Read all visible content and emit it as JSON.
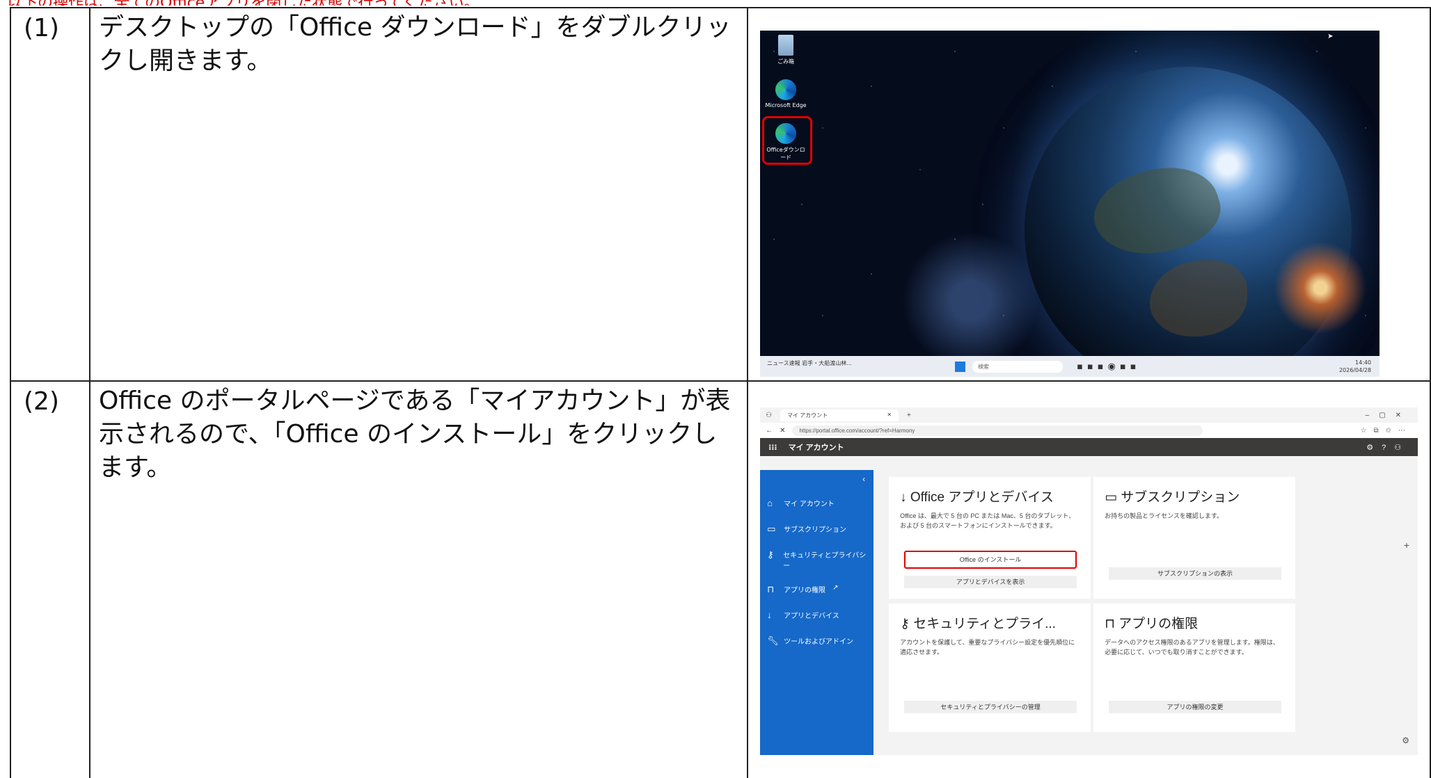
{
  "header_line": "以下の操作は、全てのOfficeアプリを閉じた状態で行ってください。",
  "steps": [
    {
      "number": "(1)",
      "text": "デスクトップの「Office ダウンロード」をダブルクリックし開きます。",
      "desktop": {
        "icons": [
          {
            "label": "ごみ箱",
            "icon": "recycle-bin-icon"
          },
          {
            "label": "Microsoft Edge",
            "icon": "edge-icon"
          },
          {
            "label": "Officeダウンロード",
            "icon": "edge-icon"
          }
        ],
        "taskbar": {
          "news": "ニュース速報 岩手・大船渡山林...",
          "search": "検索",
          "time": "14:40",
          "date": "2026/04/28"
        }
      }
    },
    {
      "number": "(2)",
      "text": "Office のポータルページである「マイアカウント」が表示されるので、「Office のインストール」をクリックします。",
      "browser": {
        "tab_title": "マイ アカウント",
        "url": "https://portal.office.com/account/?ref=Harmony",
        "app_title": "マイ アカウント",
        "nav": [
          {
            "label": "マイ アカウント",
            "icon": "home-icon"
          },
          {
            "label": "サブスクリプション",
            "icon": "card-icon"
          },
          {
            "label": "セキュリティとプライバシー",
            "icon": "key-icon"
          },
          {
            "label": "アプリの権限",
            "icon": "lock-icon"
          },
          {
            "label": "アプリとデバイス",
            "icon": "download-icon"
          },
          {
            "label": "ツールおよびアドイン",
            "icon": "wrench-icon"
          }
        ],
        "cards": {
          "apps": {
            "title": "Office アプリとデバイス",
            "desc": "Office は、最大で 5 台の PC または Mac、5 台のタブレット、および 5 台のスマートフォンにインストールできます。",
            "primary_button": "Office のインストール",
            "secondary_button": "アプリとデバイスを表示"
          },
          "subscriptions": {
            "title": "サブスクリプション",
            "desc": "お持ちの製品とライセンスを確認します。",
            "button": "サブスクリプションの表示"
          },
          "security": {
            "title": "セキュリティとプライ...",
            "desc": "アカウントを保護して、重要なプライバシー設定を優先順位に適応させます。",
            "button": "セキュリティとプライバシーの管理"
          },
          "permissions": {
            "title": "アプリの権限",
            "desc": "データへのアクセス権限のあるアプリを管理します。権限は、必要に応じて、いつでも取り消すことができます。",
            "button": "アプリの権限の変更"
          }
        }
      }
    }
  ]
}
